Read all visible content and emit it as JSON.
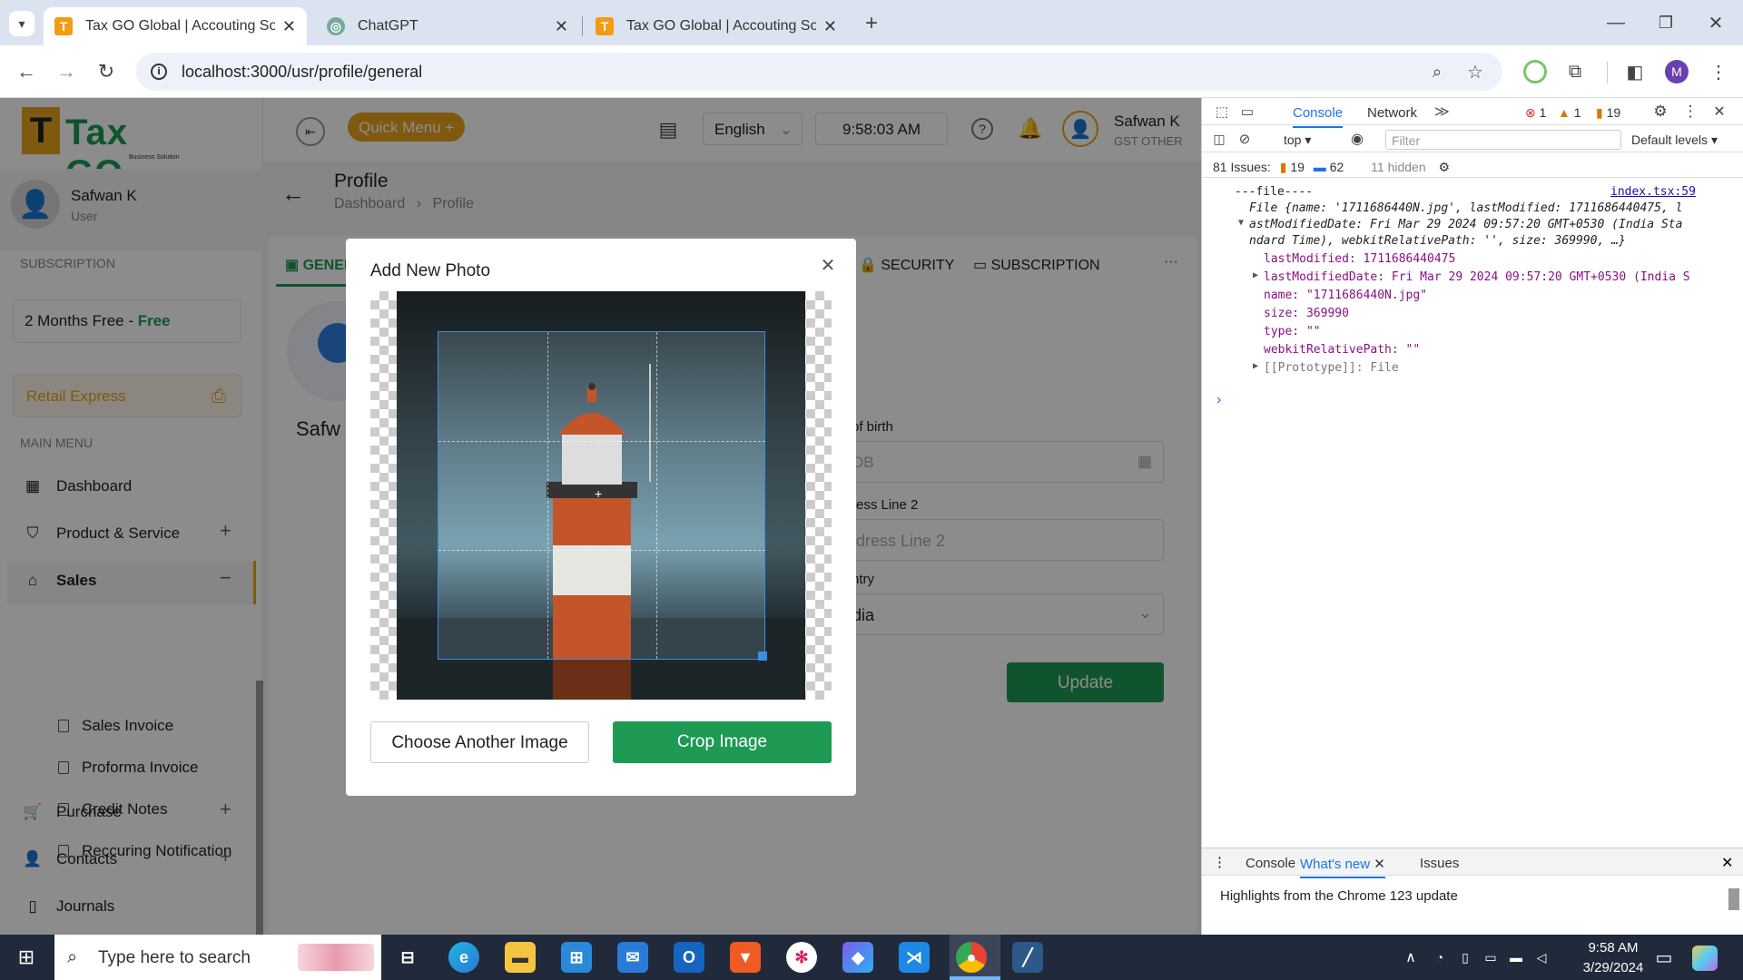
{
  "browser": {
    "tabs": [
      {
        "title": "Tax GO Global | Accouting Softw",
        "active": true
      },
      {
        "title": "ChatGPT",
        "active": false
      },
      {
        "title": "Tax GO Global | Accouting Softw",
        "active": false
      }
    ],
    "url": "localhost:3000/usr/profile/general",
    "profile_initial": "M"
  },
  "app": {
    "logo_text": "Tax GO",
    "logo_tagline": "Business Solution",
    "user": {
      "name": "Safwan K",
      "role": "User"
    },
    "subscription_heading": "SUBSCRIPTION",
    "plan": {
      "label": "2 Months Free - ",
      "tier": "Free"
    },
    "retail_express": "Retail Express",
    "main_menu_heading": "MAIN MENU",
    "menu": {
      "dashboard": "Dashboard",
      "product_service": "Product & Service",
      "sales": "Sales",
      "sales_invoice": "Sales Invoice",
      "proforma_invoice": "Proforma Invoice",
      "credit_notes": "Credit Notes",
      "reccuring_notification": "Reccuring Notification",
      "purchase": "Purchase",
      "contacts": "Contacts",
      "journals": "Journals"
    },
    "topbar": {
      "quick_menu": "Quick Menu +",
      "language": "English",
      "time": "9:58:03 AM",
      "user_name": "Safwan K",
      "user_sub": "GST OTHER"
    },
    "page": {
      "title": "Profile",
      "breadcrumb_root": "Dashboard",
      "breadcrumb_current": "Profile",
      "tab_general": "GENERAL",
      "tab_security": "SECURITY",
      "tab_subscription": "SUBSCRIPTION",
      "tab_more": "···",
      "profile_name_partial": "Safw",
      "dob_label": "of birth",
      "dob_placeholder": "DB",
      "address2_label": "ress Line 2",
      "address2_placeholder": "ldress Line 2",
      "country_label": "ntry",
      "country_value": "dia",
      "update_button": "Update"
    }
  },
  "modal": {
    "title": "Add New Photo",
    "choose_another": "Choose Another Image",
    "crop": "Crop Image"
  },
  "devtools": {
    "tabs": {
      "console": "Console",
      "network": "Network"
    },
    "errors": "1",
    "warnings": "1",
    "messages": "19",
    "context": "top",
    "filter_placeholder": "Filter",
    "levels": "Default levels",
    "issues_label": "81 Issues:",
    "issues_warn": "19",
    "issues_info": "62",
    "hidden": "11 hidden",
    "source_link": "index.tsx:59",
    "log_lines": [
      "---file----",
      "File {name: '1711686440N.jpg', lastModified: 1711686440475, l",
      "astModifiedDate: Fri Mar 29 2024 09:57:20 GMT+0530 (India Sta",
      "ndard Time), webkitRelativePath: '', size: 369990, …}",
      "lastModified: 1711686440475",
      "lastModifiedDate: Fri Mar 29 2024 09:57:20 GMT+0530 (India S",
      "name: \"1711686440N.jpg\"",
      "size: 369990",
      "type: \"\"",
      "webkitRelativePath: \"\"",
      "[[Prototype]]: File"
    ],
    "drawer_tabs": {
      "console": "Console",
      "whats_new": "What's new",
      "issues": "Issues"
    },
    "drawer_text": "Highlights from the Chrome 123 update"
  },
  "taskbar": {
    "search_placeholder": "Type here to search",
    "time": "9:58 AM",
    "date": "3/29/2024"
  },
  "colors": {
    "brand_green": "#1e9a55",
    "accent_orange": "#e8a31c",
    "devtools_blue": "#1a73e8"
  }
}
